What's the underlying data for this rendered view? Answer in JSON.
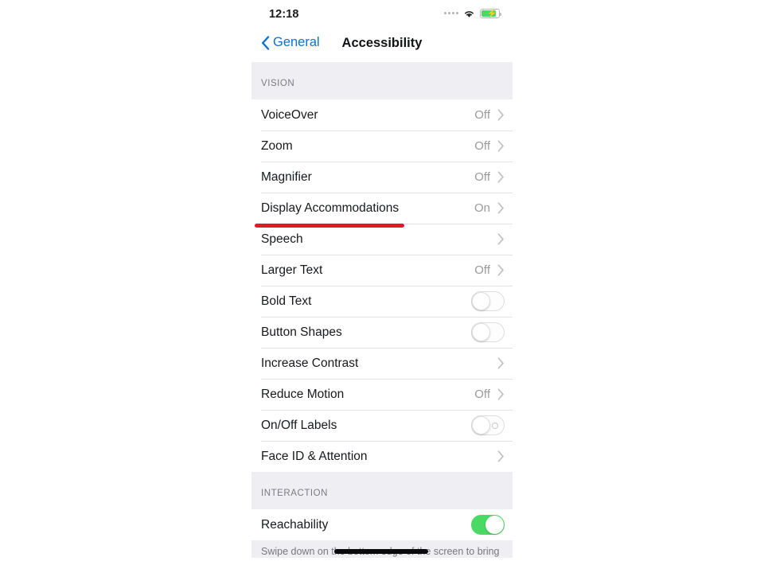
{
  "statusbar": {
    "time": "12:18",
    "signal_icon": "signal-dots-icon",
    "wifi_icon": "wifi-icon",
    "battery_icon": "battery-charging-icon"
  },
  "navbar": {
    "back_label": "General",
    "back_icon": "chevron-left-icon",
    "title": "Accessibility"
  },
  "sections": [
    {
      "header": "VISION",
      "rows": [
        {
          "label": "VoiceOver",
          "value": "Off",
          "accessory": "chevron"
        },
        {
          "label": "Zoom",
          "value": "Off",
          "accessory": "chevron"
        },
        {
          "label": "Magnifier",
          "value": "Off",
          "accessory": "chevron"
        },
        {
          "label": "Display Accommodations",
          "value": "On",
          "accessory": "chevron"
        },
        {
          "label": "Speech",
          "value": "",
          "accessory": "chevron"
        },
        {
          "label": "Larger Text",
          "value": "Off",
          "accessory": "chevron"
        },
        {
          "label": "Bold Text",
          "value": "",
          "accessory": "toggle-off"
        },
        {
          "label": "Button Shapes",
          "value": "",
          "accessory": "toggle-off"
        },
        {
          "label": "Increase Contrast",
          "value": "",
          "accessory": "chevron"
        },
        {
          "label": "Reduce Motion",
          "value": "Off",
          "accessory": "chevron"
        },
        {
          "label": "On/Off Labels",
          "value": "",
          "accessory": "toggle-off-labeled"
        },
        {
          "label": "Face ID & Attention",
          "value": "",
          "accessory": "chevron"
        }
      ]
    },
    {
      "header": "INTERACTION",
      "rows": [
        {
          "label": "Reachability",
          "value": "",
          "accessory": "toggle-on"
        }
      ]
    }
  ],
  "footer_note": "Swipe down on the bottom edge of the screen to bring",
  "annotation": {
    "type": "red-underline",
    "target_row_label": "Display Accommodations",
    "color": "#e21b1b"
  },
  "home_indicator": "home-indicator",
  "colors": {
    "accent_blue": "#0a72d4",
    "toggle_on_green": "#4ad963",
    "group_background": "#eeeef3",
    "value_gray": "#9a9a9f"
  }
}
